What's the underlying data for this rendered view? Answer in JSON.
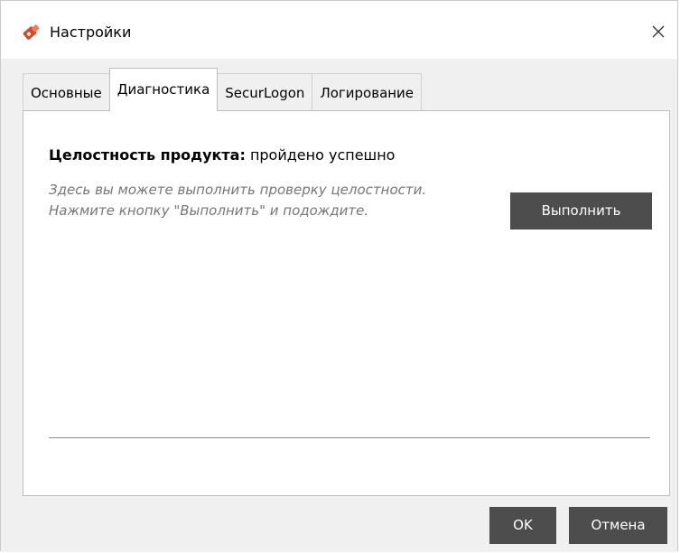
{
  "window": {
    "title": "Настройки",
    "icon": "app-logo-icon",
    "close_icon": "close-icon"
  },
  "tabs": [
    {
      "label": "Основные",
      "active": false
    },
    {
      "label": "Диагностика",
      "active": true
    },
    {
      "label": "SecurLogon",
      "active": false
    },
    {
      "label": "Логирование",
      "active": false
    }
  ],
  "diagnostics": {
    "integrity_label": "Целостность продукта:",
    "integrity_status": "пройдено успешно",
    "description": "Здесь вы можете выполнить проверку целостности. Нажмите кнопку \"Выполнить\" и подождите.",
    "run_button": "Выполнить"
  },
  "footer": {
    "ok_button": "OK",
    "cancel_button": "Отмена"
  },
  "colors": {
    "button_bg": "#4d4d4d",
    "button_text": "#ffffff",
    "hint_text": "#777777",
    "icon_accent": "#d9482b"
  }
}
